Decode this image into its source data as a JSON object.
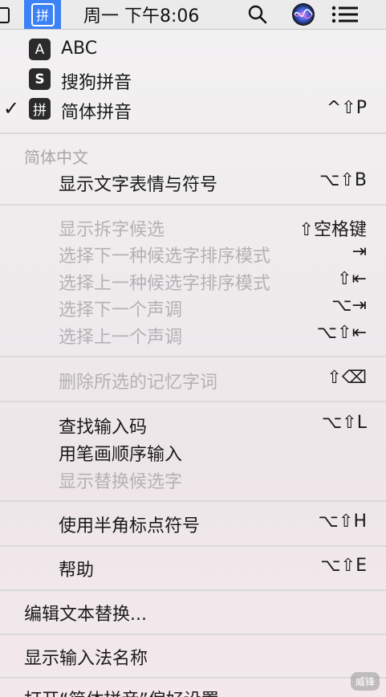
{
  "menubar": {
    "ime_glyph": "拼",
    "clock": "周一 下午8:06",
    "icons": [
      "battery-icon",
      "input-method-icon",
      "search-icon",
      "siri-icon",
      "notification-list-icon"
    ]
  },
  "sources": [
    {
      "glyph": "A",
      "label": "ABC"
    },
    {
      "glyph": "S",
      "label": "搜狗拼音"
    },
    {
      "glyph": "拼",
      "label": "简体拼音",
      "checked": true,
      "shortcut": "^⇧P"
    }
  ],
  "check_mark": "✓",
  "section_header": "简体中文",
  "items": {
    "emoji": {
      "label": "显示文字表情与符号",
      "shortcut": "⌥⇧B"
    },
    "split": {
      "label": "显示拆字候选",
      "shortcut": "⇧空格键"
    },
    "next_sort": {
      "label": "选择下一种候选字排序模式",
      "shortcut": "⇥"
    },
    "prev_sort": {
      "label": "选择上一种候选字排序模式",
      "shortcut": "⇧⇤"
    },
    "next_tone": {
      "label": "选择下一个声调",
      "shortcut": "⌥⇥"
    },
    "prev_tone": {
      "label": "选择上一个声调",
      "shortcut": "⌥⇧⇤"
    },
    "delete_memory": {
      "label": "删除所选的记忆字词",
      "shortcut": "⇧⌫"
    },
    "find_code": {
      "label": "查找输入码",
      "shortcut": "⌥⇧L"
    },
    "stroke_input": {
      "label": "用笔画顺序输入"
    },
    "show_replace": {
      "label": "显示替换候选字"
    },
    "half_width": {
      "label": "使用半角标点符号",
      "shortcut": "⌥⇧H"
    },
    "help": {
      "label": "帮助",
      "shortcut": "⌥⇧E"
    },
    "edit_replace": {
      "label": "编辑文本替换..."
    },
    "show_name": {
      "label": "显示输入法名称"
    },
    "open_prefs": {
      "label": "打开“简体拼音”偏好设置..."
    }
  },
  "watermark": "威锋"
}
